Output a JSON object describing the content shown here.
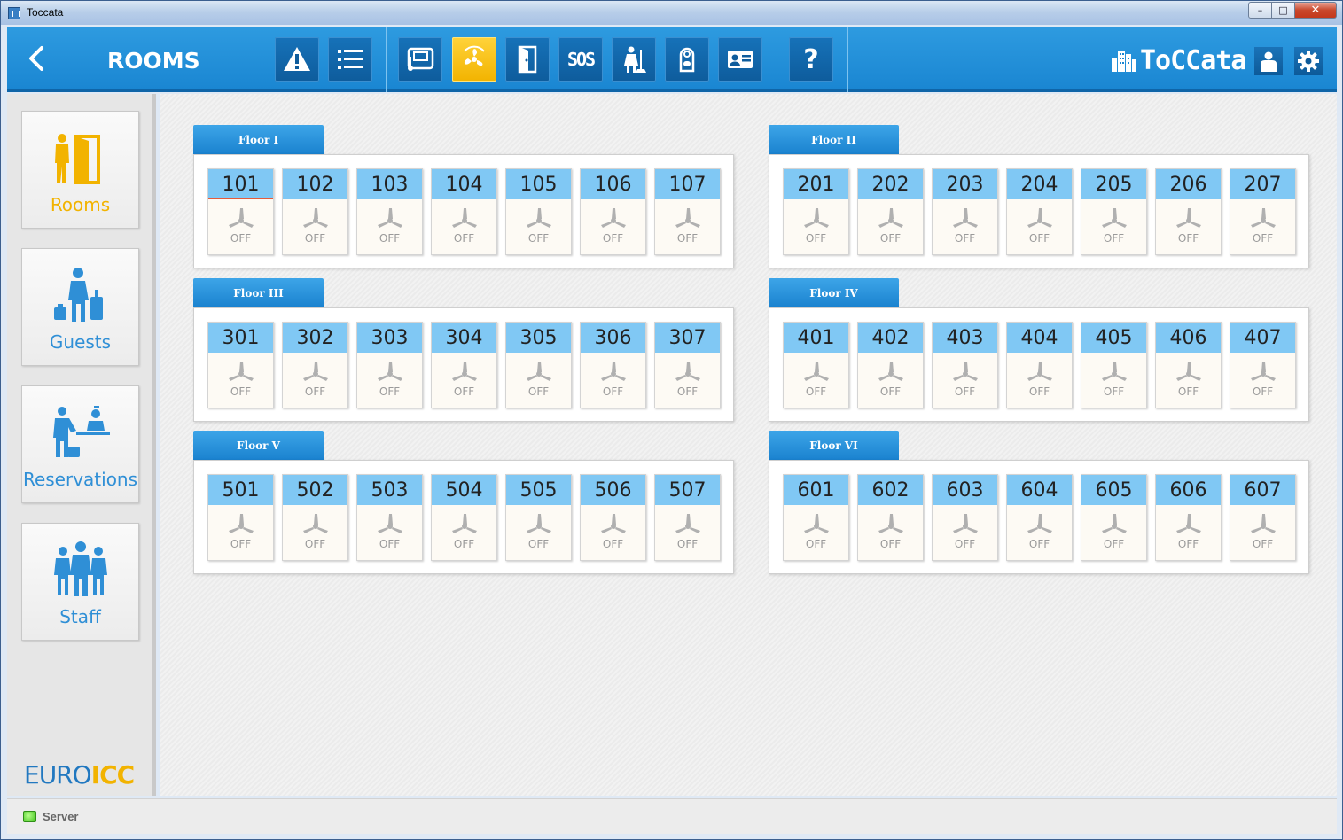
{
  "window": {
    "title": "Toccata",
    "controls": {
      "minimize": "–",
      "maximize": "□",
      "close": "✕"
    }
  },
  "header": {
    "back_icon": "chevron-left-icon",
    "title": "ROOMS",
    "toolbar": [
      {
        "id": "alarms",
        "icon": "warning-icon",
        "active": false
      },
      {
        "id": "list",
        "icon": "list-icon",
        "active": false
      },
      {
        "id": "thermostat",
        "icon": "thermostat-icon",
        "active": false
      },
      {
        "id": "fan",
        "icon": "fan-icon",
        "active": true
      },
      {
        "id": "door",
        "icon": "door-icon",
        "active": false
      },
      {
        "id": "sos",
        "label": "SOS",
        "icon": "sos-icon",
        "active": false
      },
      {
        "id": "cleaning",
        "icon": "cleaning-icon",
        "active": false
      },
      {
        "id": "do-not-disturb",
        "icon": "door-hanger-icon",
        "active": false
      },
      {
        "id": "card",
        "icon": "id-card-icon",
        "active": false
      },
      {
        "id": "help",
        "label": "?",
        "icon": "help-icon",
        "active": false
      }
    ],
    "logo_text": "ToCCata",
    "user_icon": "user-icon",
    "settings_icon": "gear-icon"
  },
  "sidebar": {
    "items": [
      {
        "id": "rooms",
        "label": "Rooms",
        "icon": "rooms-icon",
        "active": true
      },
      {
        "id": "guests",
        "label": "Guests",
        "icon": "guests-icon",
        "active": false
      },
      {
        "id": "reservations",
        "label": "Reservations",
        "icon": "reservations-icon",
        "active": false
      },
      {
        "id": "staff",
        "label": "Staff",
        "icon": "staff-icon",
        "active": false
      }
    ],
    "brand_part1": "EURO",
    "brand_part2": "ICC"
  },
  "floors": [
    {
      "name": "Floor I",
      "rooms": [
        {
          "number": "101",
          "state": "OFF",
          "selected": true
        },
        {
          "number": "102",
          "state": "OFF"
        },
        {
          "number": "103",
          "state": "OFF"
        },
        {
          "number": "104",
          "state": "OFF"
        },
        {
          "number": "105",
          "state": "OFF"
        },
        {
          "number": "106",
          "state": "OFF"
        },
        {
          "number": "107",
          "state": "OFF"
        }
      ]
    },
    {
      "name": "Floor II",
      "rooms": [
        {
          "number": "201",
          "state": "OFF"
        },
        {
          "number": "202",
          "state": "OFF"
        },
        {
          "number": "203",
          "state": "OFF"
        },
        {
          "number": "204",
          "state": "OFF"
        },
        {
          "number": "205",
          "state": "OFF"
        },
        {
          "number": "206",
          "state": "OFF"
        },
        {
          "number": "207",
          "state": "OFF"
        }
      ]
    },
    {
      "name": "Floor III",
      "rooms": [
        {
          "number": "301",
          "state": "OFF"
        },
        {
          "number": "302",
          "state": "OFF"
        },
        {
          "number": "303",
          "state": "OFF"
        },
        {
          "number": "304",
          "state": "OFF"
        },
        {
          "number": "305",
          "state": "OFF"
        },
        {
          "number": "306",
          "state": "OFF"
        },
        {
          "number": "307",
          "state": "OFF"
        }
      ]
    },
    {
      "name": "Floor IV",
      "rooms": [
        {
          "number": "401",
          "state": "OFF"
        },
        {
          "number": "402",
          "state": "OFF"
        },
        {
          "number": "403",
          "state": "OFF"
        },
        {
          "number": "404",
          "state": "OFF"
        },
        {
          "number": "405",
          "state": "OFF"
        },
        {
          "number": "406",
          "state": "OFF"
        },
        {
          "number": "407",
          "state": "OFF"
        }
      ]
    },
    {
      "name": "Floor V",
      "rooms": [
        {
          "number": "501",
          "state": "OFF"
        },
        {
          "number": "502",
          "state": "OFF"
        },
        {
          "number": "503",
          "state": "OFF"
        },
        {
          "number": "504",
          "state": "OFF"
        },
        {
          "number": "505",
          "state": "OFF"
        },
        {
          "number": "506",
          "state": "OFF"
        },
        {
          "number": "507",
          "state": "OFF"
        }
      ]
    },
    {
      "name": "Floor VI",
      "rooms": [
        {
          "number": "601",
          "state": "OFF"
        },
        {
          "number": "602",
          "state": "OFF"
        },
        {
          "number": "603",
          "state": "OFF"
        },
        {
          "number": "604",
          "state": "OFF"
        },
        {
          "number": "605",
          "state": "OFF"
        },
        {
          "number": "606",
          "state": "OFF"
        },
        {
          "number": "607",
          "state": "OFF"
        }
      ]
    }
  ],
  "status": {
    "label": "Server",
    "indicator_color": "#3fc21b"
  },
  "colors": {
    "header_blue": "#1a86d2",
    "accent_yellow": "#f2b300",
    "room_header": "#80c8f4"
  }
}
